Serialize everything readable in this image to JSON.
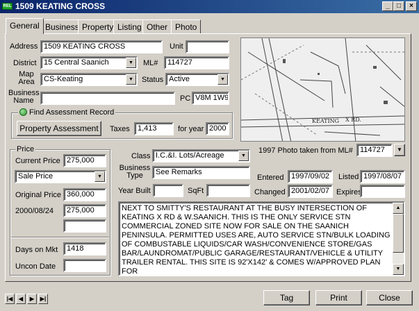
{
  "window": {
    "title": "1509 KEATING CROSS",
    "app_icon_text": "REL",
    "min_glyph": "_",
    "max_glyph": "□",
    "close_glyph": "×"
  },
  "tabs": [
    "General",
    "Business",
    "Property",
    "Listing",
    "Other",
    "Photo"
  ],
  "active_tab": "General",
  "fields": {
    "address": {
      "label": "Address",
      "value": "1509 KEATING CROSS"
    },
    "unit": {
      "label": "Unit",
      "value": ""
    },
    "district": {
      "label": "District",
      "value": "15 Central Saanich"
    },
    "ml": {
      "label": "ML#",
      "value": "114727"
    },
    "map_area": {
      "label": "Map Area",
      "value": "CS-Keating"
    },
    "status": {
      "label": "Status",
      "value": "Active"
    },
    "business_name": {
      "label": "Business Name",
      "value": ""
    },
    "pc": {
      "label": "PC",
      "value": "V8M 1W9"
    }
  },
  "assessment": {
    "group_title": "Find Assessment Record",
    "button": "Property Assessment",
    "taxes_label": "Taxes",
    "taxes": "1,413",
    "for_year_label": "for year",
    "year": "2000"
  },
  "photo": {
    "caption": "1997 Photo taken from ML#",
    "ml": "114727",
    "map_labels": [
      "KEATING",
      "X RD."
    ]
  },
  "price": {
    "group_title": "Price",
    "current_label": "Current Price",
    "current": "275,000",
    "type": "Sale Price",
    "original_label": "Original Price",
    "original": "360,000",
    "date_label": "2000/08/24",
    "date_value": "275,000",
    "extra": ""
  },
  "market": {
    "days_label": "Days on Mkt",
    "days": "1418",
    "uncon_label": "Uncon Date",
    "uncon": ""
  },
  "details": {
    "class_label": "Class",
    "class": "I.C.&I. Lots/Acreage",
    "btype_label": "Business Type",
    "btype": "See Remarks",
    "entered_label": "Entered",
    "entered": "1997/09/02",
    "listed_label": "Listed",
    "listed": "1997/08/07",
    "year_built_label": "Year Built",
    "year_built": "",
    "sqft_label": "SqFt",
    "sqft": "",
    "changed_label": "Changed",
    "changed": "2001/02/07",
    "expires_label": "Expires",
    "expires": ""
  },
  "remarks": "NEXT TO SMITTY'S RESTAURANT AT THE BUSY INTERSECTION OF KEATING X RD & W.SAANICH. THIS IS THE ONLY SERVICE STN COMMERCIAL ZONED SITE NOW FOR SALE ON THE SAANICH PENINSULA. PERMITTED USES ARE, AUTO SERVICE STN/BULK LOADING OF COMBUSTABLE LIQUIDS/CAR WASH/CONVENIENCE STORE/GAS BAR/LAUNDROMAT/PUBLIC GARAGE/RESTAURANT/VEHICLE & UTILITY TRAILER RENTAL. THIS SITE IS 92'X142' & COMES W/APPROVED PLAN FOR",
  "buttons": {
    "tag": "Tag",
    "print": "Print",
    "close": "Close"
  },
  "nav": {
    "first": "|◀",
    "prev": "◀",
    "next": "▶",
    "last": "▶|"
  },
  "glyphs": {
    "dropdown": "▼",
    "scroll_up": "▲",
    "scroll_down": "▼"
  }
}
